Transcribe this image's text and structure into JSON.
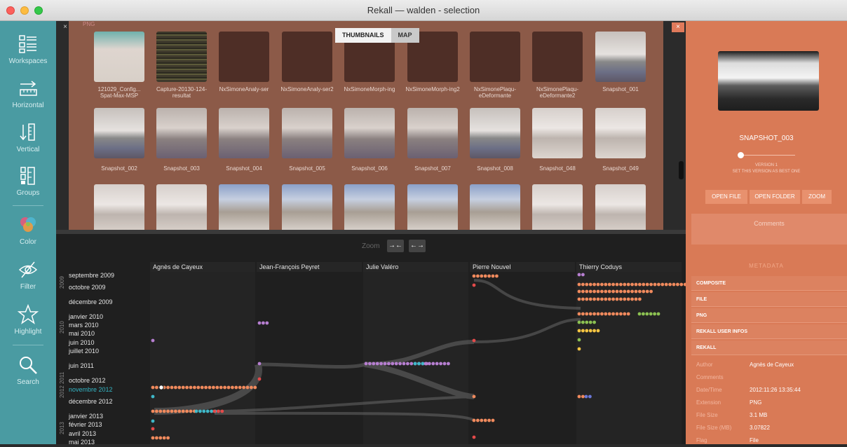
{
  "window": {
    "title": "Rekall — walden - selection"
  },
  "sidebar": {
    "items": [
      {
        "label": "Workspaces",
        "icon": "workspaces-icon"
      },
      {
        "label": "Horizontal",
        "icon": "horizontal-icon"
      },
      {
        "label": "Vertical",
        "icon": "vertical-icon"
      },
      {
        "label": "Groups",
        "icon": "groups-icon"
      },
      {
        "label": "Color",
        "icon": "color-icon"
      },
      {
        "label": "Filter",
        "icon": "filter-icon"
      },
      {
        "label": "Highlight",
        "icon": "highlight-icon"
      },
      {
        "label": "Search",
        "icon": "search-icon"
      }
    ]
  },
  "thumbnails": {
    "section_label": "PNG",
    "tabs": [
      "THUMBNAILS",
      "MAP"
    ],
    "active_tab": "THUMBNAILS",
    "close_glyph": "×",
    "items": [
      {
        "label": "121029_Config... Spat-Max-MSP",
        "style": "img1"
      },
      {
        "label": "Capture-20130-124-resultat",
        "style": "img2"
      },
      {
        "label": "NxSimoneAnaly-ser",
        "style": "blank"
      },
      {
        "label": "NxSimoneAnaly-ser2",
        "style": "blank"
      },
      {
        "label": "NxSimoneMorph-ing",
        "style": "blank"
      },
      {
        "label": "NxSimoneMorph-ing2",
        "style": "blank"
      },
      {
        "label": "NxSimonePlaqu-eDeformante",
        "style": "blank"
      },
      {
        "label": "NxSimonePlaqu-eDeformante2",
        "style": "blank"
      },
      {
        "label": "Snapshot_001",
        "style": "sky"
      },
      {
        "label": "Snapshot_002",
        "style": "sky"
      },
      {
        "label": "Snapshot_003",
        "style": "sky2"
      },
      {
        "label": "Snapshot_004",
        "style": "sky2"
      },
      {
        "label": "Snapshot_005",
        "style": "sky2"
      },
      {
        "label": "Snapshot_006",
        "style": "sky2"
      },
      {
        "label": "Snapshot_007",
        "style": "sky2"
      },
      {
        "label": "Snapshot_008",
        "style": "sky"
      },
      {
        "label": "Snapshot_048",
        "style": "trees"
      },
      {
        "label": "Snapshot_049",
        "style": "trees"
      },
      {
        "label": "",
        "style": "trees"
      },
      {
        "label": "",
        "style": "trees"
      },
      {
        "label": "",
        "style": "trees2"
      },
      {
        "label": "",
        "style": "trees2"
      },
      {
        "label": "",
        "style": "trees2"
      },
      {
        "label": "",
        "style": "trees2"
      },
      {
        "label": "",
        "style": "trees2"
      },
      {
        "label": "",
        "style": "trees"
      },
      {
        "label": "",
        "style": "trees"
      }
    ]
  },
  "timeline": {
    "zoom_label": "Zoom",
    "zoom_in_glyph": "→←",
    "zoom_out_glyph": "←→",
    "authors": [
      "Agnès de Cayeux",
      "Jean-François Peyret",
      "Julie Valéro",
      "Pierre Nouvel",
      "Thierry Coduys"
    ],
    "years": [
      "2009",
      "2010",
      "2012 2011",
      "2013"
    ],
    "rows": [
      {
        "label": "septembre 2009",
        "highlight": false
      },
      {
        "label": "octobre 2009",
        "highlight": false
      },
      {
        "label": "décembre 2009",
        "highlight": false
      },
      {
        "label": "janvier 2010",
        "highlight": false
      },
      {
        "label": "mars 2010",
        "highlight": false
      },
      {
        "label": "mai 2010",
        "highlight": false
      },
      {
        "label": "juin 2010",
        "highlight": false
      },
      {
        "label": "juillet 2010",
        "highlight": false
      },
      {
        "label": "juin 2011",
        "highlight": false
      },
      {
        "label": "octobre 2012",
        "highlight": false
      },
      {
        "label": "novembre 2012",
        "highlight": true
      },
      {
        "label": "décembre 2012",
        "highlight": false
      },
      {
        "label": "janvier 2013",
        "highlight": false
      },
      {
        "label": "février 2013",
        "highlight": false
      },
      {
        "label": "avril 2013",
        "highlight": false
      },
      {
        "label": "mai 2013",
        "highlight": false
      }
    ]
  },
  "details": {
    "title": "SNAPSHOT_003",
    "version_line1": "VERSION 1",
    "version_line2": "SET THIS VERSION AS BEST ONE",
    "buttons": [
      "OPEN FILE",
      "OPEN FOLDER",
      "ZOOM"
    ],
    "comments_placeholder": "Comments",
    "metadata_header": "METADATA",
    "sections": [
      "COMPOSITE",
      "FILE",
      "PNG",
      "REKALL USER INFOS",
      "REKALL"
    ],
    "fields": [
      {
        "key": "Author",
        "value": "Agnès de Cayeux"
      },
      {
        "key": "Comments",
        "value": ""
      },
      {
        "key": "Date/Time",
        "value": "2012:11:26 13:35:44"
      },
      {
        "key": "Extension",
        "value": "PNG"
      },
      {
        "key": "File Size",
        "value": "3.1 MB"
      },
      {
        "key": "File Size (MB)",
        "value": "3.07822"
      },
      {
        "key": "Flag",
        "value": "File"
      }
    ]
  },
  "colors": {
    "sidebar": "#4a9ba2",
    "thumb_bg": "#8c5a48",
    "right_panel": "#d97a56",
    "highlight_text": "#34b5c4"
  }
}
